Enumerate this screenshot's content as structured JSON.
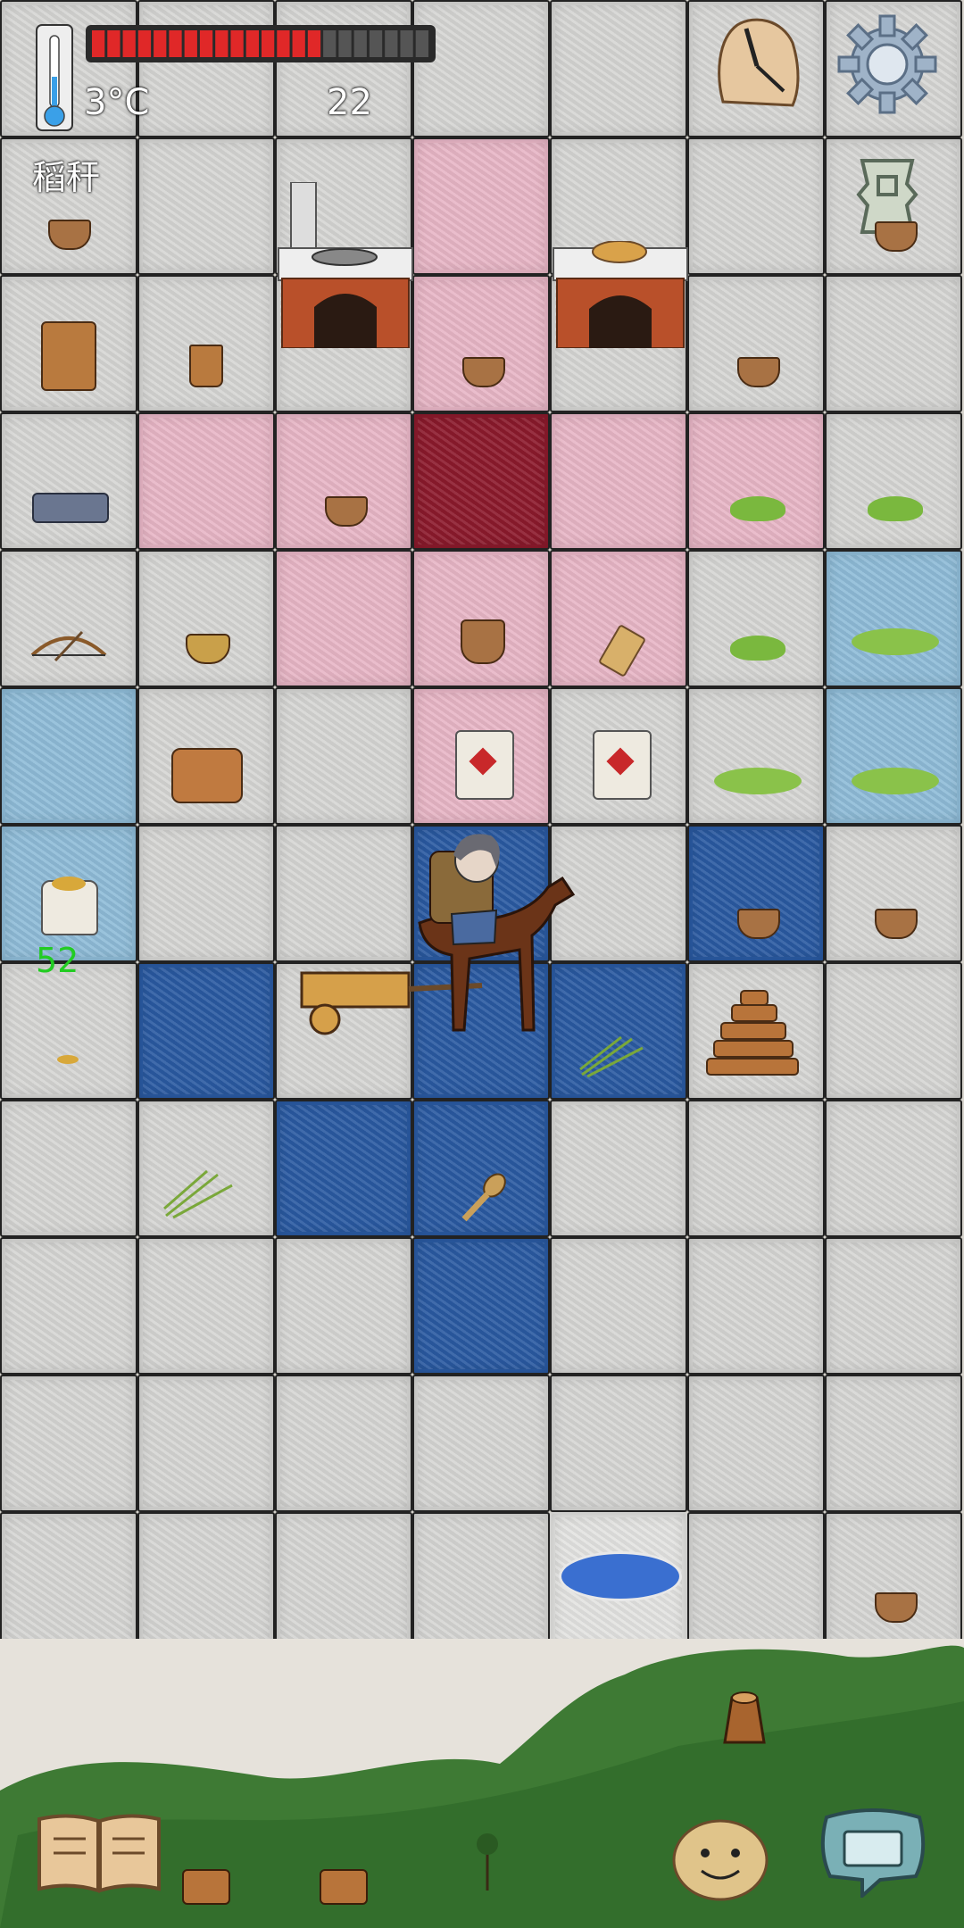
{
  "hud": {
    "temperature": "3°C",
    "food_counter": "22",
    "held_item": "稻秆",
    "health_segments_total": 22,
    "health_segments_filled": 15,
    "age_readout": "52"
  },
  "colors": {
    "health_fill": "#e02828",
    "health_empty": "#555555",
    "age_text": "#22cc22"
  },
  "icons": {
    "thermometer": "thermometer-icon",
    "clock": "clock-icon",
    "settings": "gear-icon",
    "tech_tree": "coin-emblem-icon",
    "book": "book-icon",
    "emote": "face-icon",
    "keyboard": "keyboard-icon"
  },
  "grid": {
    "rows": [
      [
        "white",
        "white",
        "white",
        "white",
        "white",
        "white",
        "white"
      ],
      [
        "white",
        "white",
        "white",
        "pink",
        "white",
        "white",
        "white"
      ],
      [
        "white",
        "white",
        "white",
        "pink",
        "white",
        "white",
        "white"
      ],
      [
        "white",
        "pink",
        "pink",
        "dred",
        "pink",
        "pink",
        "white"
      ],
      [
        "white",
        "white",
        "pink",
        "pink",
        "pink",
        "white",
        "lblue"
      ],
      [
        "lblue",
        "white",
        "white",
        "pink",
        "white",
        "white",
        "lblue"
      ],
      [
        "lblue",
        "white",
        "white",
        "dblue",
        "white",
        "dblue",
        "white"
      ],
      [
        "white",
        "dblue",
        "white",
        "dblue",
        "dblue",
        "white",
        "white"
      ],
      [
        "white",
        "white",
        "dblue",
        "dblue",
        "white",
        "white",
        "white"
      ],
      [
        "white",
        "white",
        "white",
        "dblue",
        "white",
        "white",
        "white"
      ],
      [
        "white",
        "white",
        "white",
        "white",
        "white",
        "white",
        "white"
      ],
      [
        "white",
        "white",
        "white",
        "white",
        "plain",
        "white",
        "white"
      ]
    ]
  }
}
